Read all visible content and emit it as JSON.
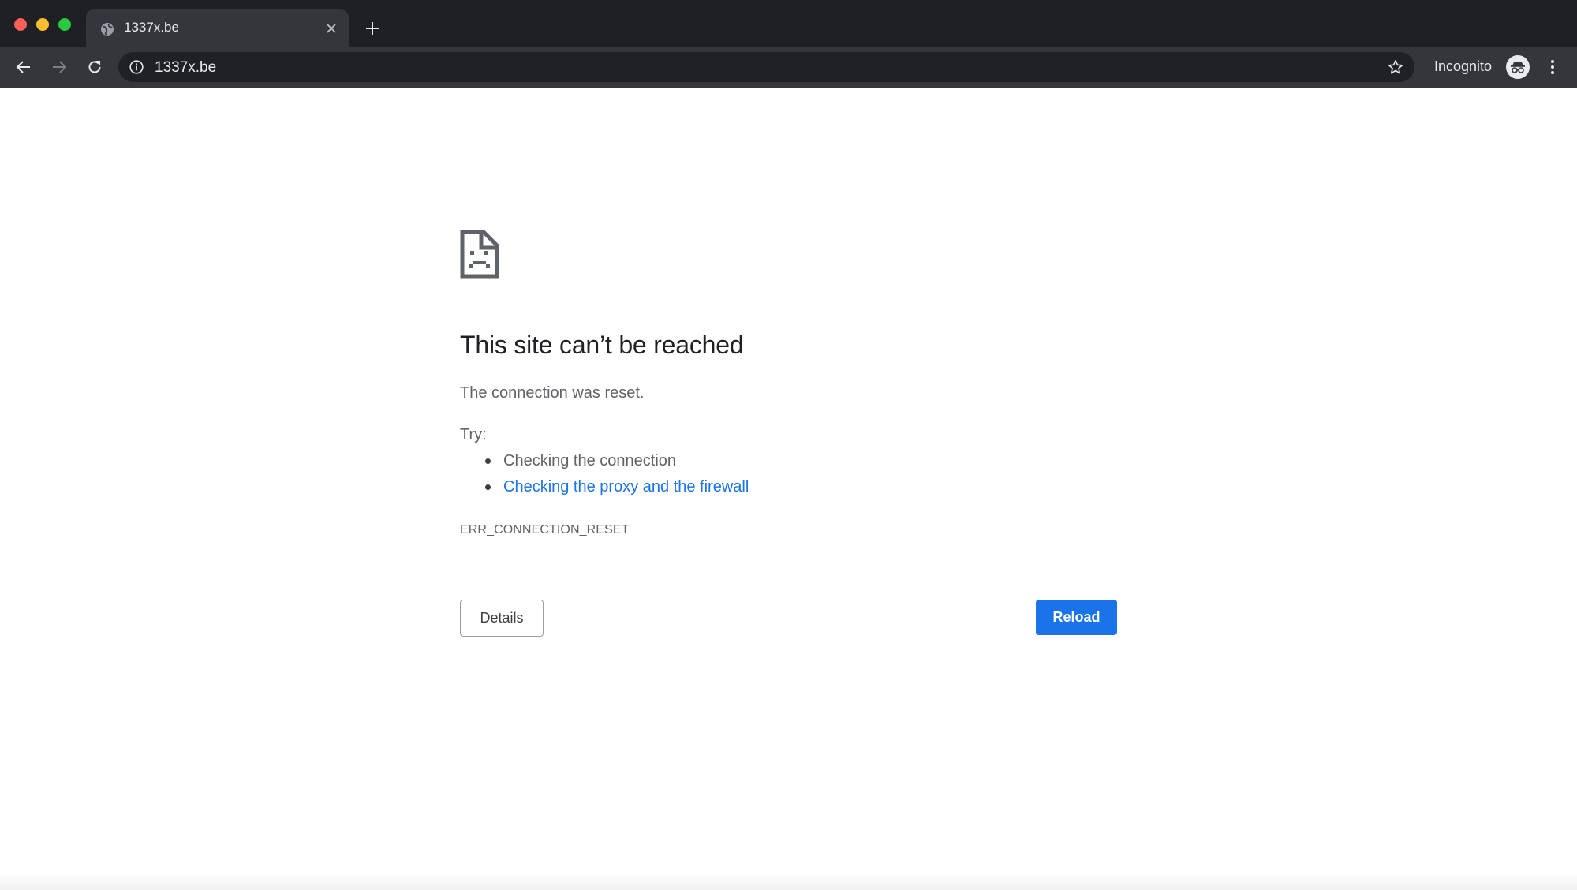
{
  "window": {
    "colors": {
      "close": "#ff5f57",
      "minimize": "#febc2e",
      "maximize": "#28c840"
    }
  },
  "tab": {
    "title": "1337x.be",
    "favicon": "globe-icon"
  },
  "toolbar": {
    "url": "1337x.be",
    "incognito_label": "Incognito",
    "icons": [
      "back-icon",
      "forward-icon",
      "reload-icon",
      "info-icon",
      "star-icon",
      "incognito-icon",
      "menu-icon"
    ]
  },
  "error": {
    "icon": "sad-page-icon",
    "heading": "This site can’t be reached",
    "summary": "The connection was reset.",
    "try_label": "Try:",
    "suggestions": [
      {
        "text": "Checking the connection",
        "is_link": false
      },
      {
        "text": "Checking the proxy and the firewall",
        "is_link": true
      }
    ],
    "code": "ERR_CONNECTION_RESET",
    "details_label": "Details",
    "reload_label": "Reload",
    "colors": {
      "link": "#1a73e8",
      "primary_button": "#1a73e8",
      "text": "#5f6368",
      "heading": "#202124"
    }
  }
}
